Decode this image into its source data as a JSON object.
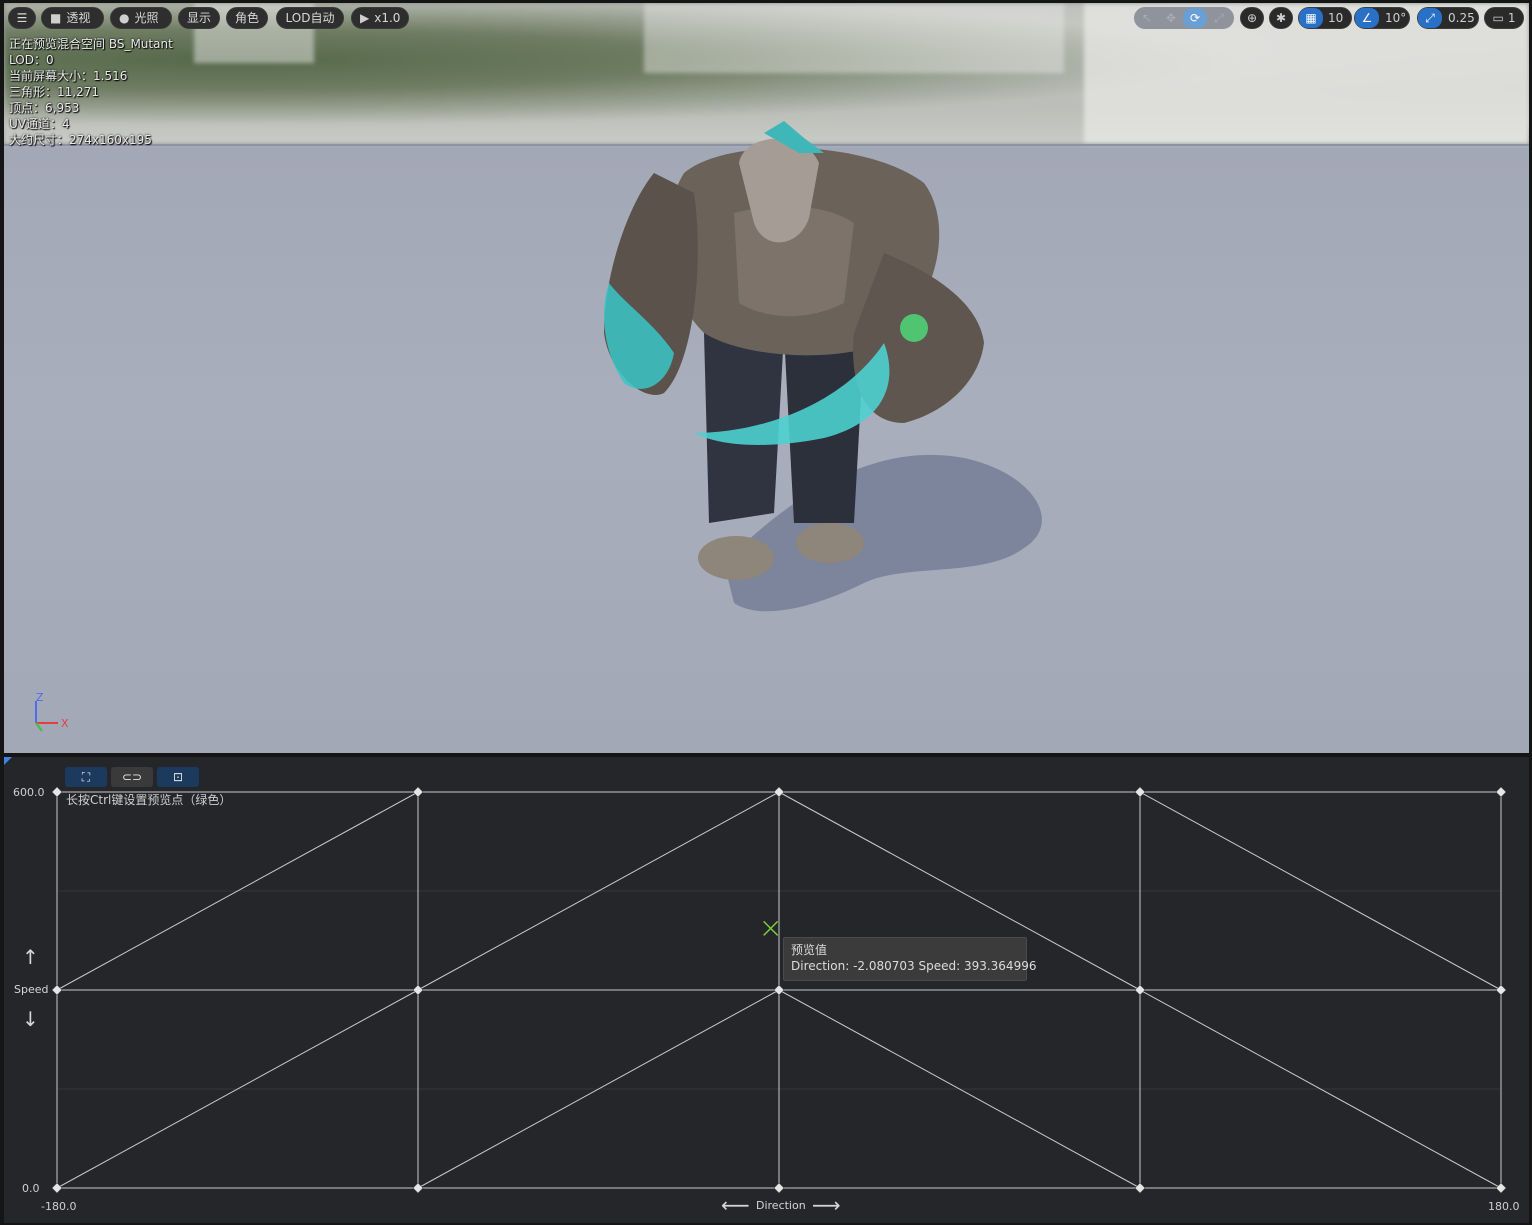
{
  "toolbar": {
    "menu_icon": "hamburger-menu-icon",
    "perspective_label": "透视",
    "lighting_label": "光照",
    "show_label": "显示",
    "character_label": "角色",
    "lod_label": "LOD自动",
    "play_speed_label": "x1.0"
  },
  "right_toolbar": {
    "grid_snap_value": "10",
    "rotation_snap_value": "10°",
    "scale_snap_value": "0.25",
    "camera_speed_value": "1"
  },
  "stats": {
    "preview_line": "正在预览混合空间 BS_Mutant",
    "lod_line": "LOD：0",
    "screen_size_line": "当前屏幕大小：1.516",
    "triangles_line": "三角形：11,271",
    "vertices_line": "顶点：6,953",
    "uv_channels_line": "UV通道：4",
    "approx_size_line": "大约尺寸：274x160x195"
  },
  "axes_gizmo": {
    "z_label": "Z",
    "x_label": "X"
  },
  "blendspace": {
    "hint": "长按Ctrl键设置预览点（绿色）",
    "y_axis_name": "Speed",
    "x_axis_name": "Direction",
    "y_max_label": "600.0",
    "y_min_label": "0.0",
    "x_min_label": "-180.0",
    "x_max_label": "180.0",
    "tooltip_title": "预览值",
    "tooltip_value": "Direction: -2.080703  Speed: 393.364996",
    "preview_point": {
      "direction": -2.080703,
      "speed": 393.364996
    },
    "x_range": [
      -180,
      180
    ],
    "y_range": [
      0,
      600
    ],
    "sample_points": [
      {
        "direction": -180,
        "speed": 0
      },
      {
        "direction": -90,
        "speed": 0
      },
      {
        "direction": 0,
        "speed": 0
      },
      {
        "direction": 90,
        "speed": 0
      },
      {
        "direction": 180,
        "speed": 0
      },
      {
        "direction": -180,
        "speed": 300
      },
      {
        "direction": -90,
        "speed": 300
      },
      {
        "direction": 0,
        "speed": 300
      },
      {
        "direction": 90,
        "speed": 300
      },
      {
        "direction": 180,
        "speed": 300
      },
      {
        "direction": -180,
        "speed": 600
      },
      {
        "direction": -90,
        "speed": 600
      },
      {
        "direction": 0,
        "speed": 600
      },
      {
        "direction": 90,
        "speed": 600
      },
      {
        "direction": 180,
        "speed": 600
      }
    ]
  }
}
